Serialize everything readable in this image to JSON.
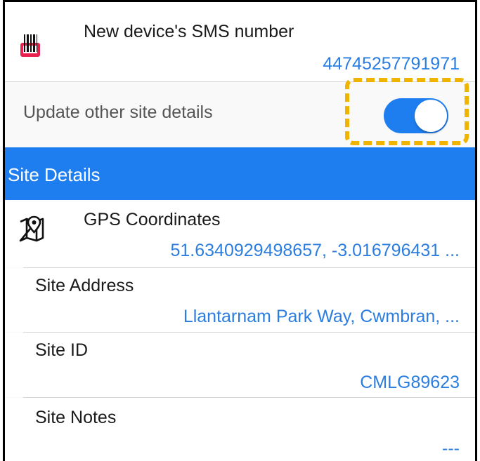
{
  "device": {
    "sms_label": "New device's SMS number",
    "sms_value": "44745257791971",
    "icon": "barcode-icon"
  },
  "update": {
    "label": "Update other site details",
    "toggle_on": true
  },
  "section": {
    "title": "Site Details"
  },
  "gps": {
    "label": "GPS Coordinates",
    "value": "51.6340929498657, -3.016796431 ...",
    "icon": "map-pin-icon"
  },
  "address": {
    "label": "Site Address",
    "value": "Llantarnam Park Way, Cwmbran, ..."
  },
  "site_id": {
    "label": "Site ID",
    "value": "CMLG89623"
  },
  "notes": {
    "label": "Site Notes",
    "value": "---"
  },
  "colors": {
    "accent": "#1e7ef0",
    "link": "#2b7de0",
    "highlight": "#f0b400",
    "icon_red": "#e8214f"
  }
}
